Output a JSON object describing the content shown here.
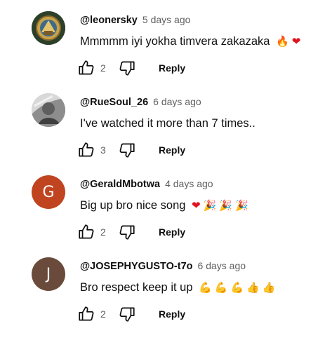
{
  "comments": [
    {
      "author": "@leonersky",
      "time": "5 days ago",
      "text": "Mmmmm iyi yokha timvera zakazaka",
      "emoji": [
        {
          "char": "🔥",
          "icon": "fire-emoji",
          "cls": "fire"
        },
        {
          "char": "❤",
          "icon": "heart-emoji",
          "cls": "heart"
        }
      ],
      "likes": "2",
      "reply_label": "Reply",
      "avatar": {
        "type": "image",
        "icon": "emblem-avatar",
        "color": "#3b5b3a"
      }
    },
    {
      "author": "@RueSoul_26",
      "time": "6 days ago",
      "text": "I've watched it more than 7 times..",
      "emoji": [],
      "likes": "3",
      "reply_label": "Reply",
      "avatar": {
        "type": "image",
        "icon": "photo-avatar",
        "color": "#9a9a9a"
      }
    },
    {
      "author": "@GeraldMbotwa",
      "time": "4 days ago",
      "text": "Big up bro nice song",
      "emoji": [
        {
          "char": "❤",
          "icon": "heart-emoji",
          "cls": "heart"
        },
        {
          "char": "🎉",
          "icon": "party-popper-emoji",
          "cls": "party"
        },
        {
          "char": "🎉",
          "icon": "party-popper-emoji",
          "cls": "party"
        },
        {
          "char": "🎉",
          "icon": "party-popper-emoji",
          "cls": "party"
        }
      ],
      "likes": "2",
      "reply_label": "Reply",
      "avatar": {
        "type": "letter",
        "letter": "G",
        "color": "#c0441f"
      }
    },
    {
      "author": "@JOSEPHYGUSTO-t7o",
      "time": "6 days ago",
      "text": "Bro respect keep it up",
      "emoji": [
        {
          "char": "💪",
          "icon": "flexed-biceps-emoji",
          "cls": "flex"
        },
        {
          "char": "💪",
          "icon": "flexed-biceps-emoji",
          "cls": "flex"
        },
        {
          "char": "💪",
          "icon": "flexed-biceps-emoji",
          "cls": "flex"
        },
        {
          "char": "👍",
          "icon": "thumbs-up-emoji",
          "cls": "thumb"
        },
        {
          "char": "👍",
          "icon": "thumbs-up-emoji",
          "cls": "thumb"
        }
      ],
      "likes": "2",
      "reply_label": "Reply",
      "avatar": {
        "type": "letter",
        "letter": "J",
        "color": "#6a4a3a"
      }
    }
  ],
  "icons": {
    "like": "thumb-up-outline-icon",
    "dislike": "thumb-down-outline-icon"
  }
}
